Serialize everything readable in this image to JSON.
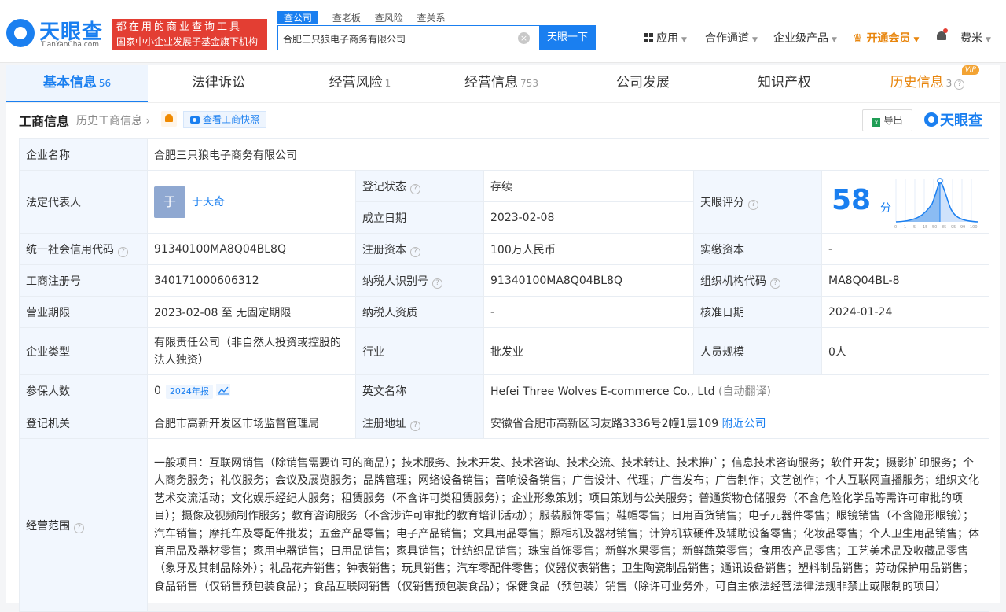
{
  "header": {
    "logo_text": "天眼查",
    "logo_sub": "TianYanCha.com",
    "promo_line1": "都在用的商业查询工具",
    "promo_line2": "国家中小企业发展子基金旗下机构",
    "search_tabs": [
      "查公司",
      "查老板",
      "查风险",
      "查关系"
    ],
    "search_value": "合肥三只狼电子商务有限公司",
    "search_button": "天眼一下",
    "nav": {
      "apps": "应用",
      "partner": "合作通道",
      "enterprise": "企业级产品",
      "vip": "开通会员",
      "user": "费米"
    }
  },
  "tabs": [
    {
      "label": "基本信息",
      "count": "56"
    },
    {
      "label": "法律诉讼",
      "count": ""
    },
    {
      "label": "经营风险",
      "count": "1"
    },
    {
      "label": "经营信息",
      "count": "753"
    },
    {
      "label": "公司发展",
      "count": ""
    },
    {
      "label": "知识产权",
      "count": ""
    },
    {
      "label": "历史信息",
      "count": "3",
      "tag": "VIP"
    }
  ],
  "section": {
    "title": "工商信息",
    "history_link": "历史工商信息",
    "snapshot_btn": "查看工商快照",
    "export_btn": "导出",
    "brand": "天眼查"
  },
  "info": {
    "company_name_k": "企业名称",
    "company_name_v": "合肥三只狼电子商务有限公司",
    "legal_rep_k": "法定代表人",
    "legal_rep_avatar": "于",
    "legal_rep_v": "于天奇",
    "reg_status_k": "登记状态",
    "reg_status_v": "存续",
    "founded_k": "成立日期",
    "founded_v": "2023-02-08",
    "score_k": "天眼评分",
    "score_v": "58",
    "score_unit": "分",
    "score_axis": [
      "0",
      "1",
      "5",
      "15",
      "50",
      "85",
      "95",
      "99",
      "100"
    ],
    "credit_code_k": "统一社会信用代码",
    "credit_code_v": "91340100MA8Q04BL8Q",
    "reg_capital_k": "注册资本",
    "reg_capital_v": "100万人民币",
    "paid_capital_k": "实缴资本",
    "paid_capital_v": "-",
    "reg_no_k": "工商注册号",
    "reg_no_v": "340171000606312",
    "taxpayer_id_k": "纳税人识别号",
    "taxpayer_id_v": "91340100MA8Q04BL8Q",
    "org_code_k": "组织机构代码",
    "org_code_v": "MA8Q04BL-8",
    "term_k": "营业期限",
    "term_v": "2023-02-08 至 无固定期限",
    "taxpayer_q_k": "纳税人资质",
    "taxpayer_q_v": "-",
    "approve_k": "核准日期",
    "approve_v": "2024-01-24",
    "type_k": "企业类型",
    "type_v": "有限责任公司（非自然人投资或控股的法人独资）",
    "industry_k": "行业",
    "industry_v": "批发业",
    "staff_k": "人员规模",
    "staff_v": "0人",
    "insured_k": "参保人数",
    "insured_v": "0",
    "insured_badge": "2024年报",
    "en_name_k": "英文名称",
    "en_name_v": "Hefei Three Wolves E-commerce Co., Ltd",
    "en_name_note": "(自动翻译)",
    "authority_k": "登记机关",
    "authority_v": "合肥市高新开发区市场监督管理局",
    "address_k": "注册地址",
    "address_v": "安徽省合肥市高新区习友路3336号2幢1层109",
    "address_link": "附近公司",
    "scope_k": "经营范围",
    "scope_v": "一般项目：互联网销售（除销售需要许可的商品）；技术服务、技术开发、技术咨询、技术交流、技术转让、技术推广；信息技术咨询服务；软件开发；摄影扩印服务；个人商务服务；礼仪服务；会议及展览服务；品牌管理；网络设备销售；音响设备销售；广告设计、代理；广告发布；广告制作；文艺创作；个人互联网直播服务；组织文化艺术交流活动；文化娱乐经纪人服务；租赁服务（不含许可类租赁服务）；企业形象策划；项目策划与公关服务；普通货物仓储服务（不含危险化学品等需许可审批的项目）；摄像及视频制作服务；教育咨询服务（不含涉许可审批的教育培训活动）；服装服饰零售；鞋帽零售；日用百货销售；电子元器件零售；眼镜销售（不含隐形眼镜）；汽车销售；摩托车及零配件批发；五金产品零售；电子产品销售；文具用品零售；照相机及器材销售；计算机软硬件及辅助设备零售；化妆品零售；个人卫生用品销售；体育用品及器材零售；家用电器销售；日用品销售；家具销售；针纺织品销售；珠宝首饰零售；新鲜水果零售；新鲜蔬菜零售；食用农产品零售；工艺美术品及收藏品零售（象牙及其制品除外）；礼品花卉销售；钟表销售；玩具销售；汽车零配件零售；仪器仪表销售；卫生陶瓷制品销售；通讯设备销售；塑料制品销售；劳动保护用品销售；食品销售（仅销售预包装食品）；食品互联网销售（仅销售预包装食品）；保健食品（预包装）销售（除许可业务外，可自主依法经营法律法规非禁止或限制的项目）"
  }
}
